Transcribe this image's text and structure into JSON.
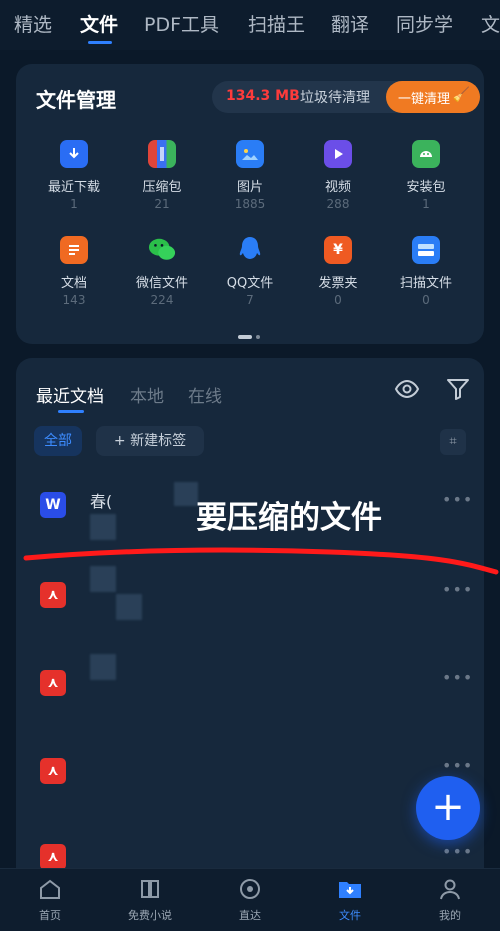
{
  "top_tabs": [
    "精选",
    "文件",
    "PDF工具",
    "扫描王",
    "翻译",
    "同步学",
    "文"
  ],
  "active_tab": "文件",
  "file_manager": {
    "title": "文件管理",
    "junk_size": "134.3 MB",
    "junk_label": "垃圾待清理",
    "clean_button": "一键清理",
    "categories": [
      {
        "label": "最近下载",
        "count": "1",
        "icon": "download-icon",
        "color": "#2a6df4"
      },
      {
        "label": "压缩包",
        "count": "21",
        "icon": "archive-icon",
        "color": "#e0453a"
      },
      {
        "label": "图片",
        "count": "1885",
        "icon": "image-icon",
        "color": "#2a7df6"
      },
      {
        "label": "视频",
        "count": "288",
        "icon": "video-icon",
        "color": "#6b4ee8"
      },
      {
        "label": "安装包",
        "count": "1",
        "icon": "android-icon",
        "color": "#3bb35c"
      },
      {
        "label": "文档",
        "count": "143",
        "icon": "document-icon",
        "color": "#f06a22"
      },
      {
        "label": "微信文件",
        "count": "224",
        "icon": "wechat-icon",
        "color": "#2bbf4a"
      },
      {
        "label": "QQ文件",
        "count": "7",
        "icon": "qq-icon",
        "color": "#2a7df6"
      },
      {
        "label": "发票夹",
        "count": "0",
        "icon": "invoice-icon",
        "color": "#ef5a22"
      },
      {
        "label": "扫描文件",
        "count": "0",
        "icon": "scan-icon",
        "color": "#2a7df6"
      }
    ]
  },
  "recent": {
    "tabs": [
      "最近文档",
      "本地",
      "在线"
    ],
    "active_tab": "最近文档",
    "filter_all": "全部",
    "new_tag": "新建标签",
    "files": [
      {
        "name": "春(",
        "type": "word"
      },
      {
        "name": "",
        "type": "pdf"
      },
      {
        "name": "",
        "type": "pdf"
      },
      {
        "name": "",
        "type": "pdf"
      },
      {
        "name": "",
        "type": "pdf"
      }
    ],
    "annotation": "要压缩的文件"
  },
  "bottom_nav": [
    {
      "label": "首页",
      "icon": "home-icon"
    },
    {
      "label": "免费小说",
      "icon": "book-icon"
    },
    {
      "label": "直达",
      "icon": "compass-icon"
    },
    {
      "label": "文件",
      "icon": "folder-icon"
    },
    {
      "label": "我的",
      "icon": "profile-icon"
    }
  ],
  "colors": {
    "accent": "#2f80ff",
    "annotation_line": "#ff1a1a",
    "clean_button": "#f07a22"
  }
}
